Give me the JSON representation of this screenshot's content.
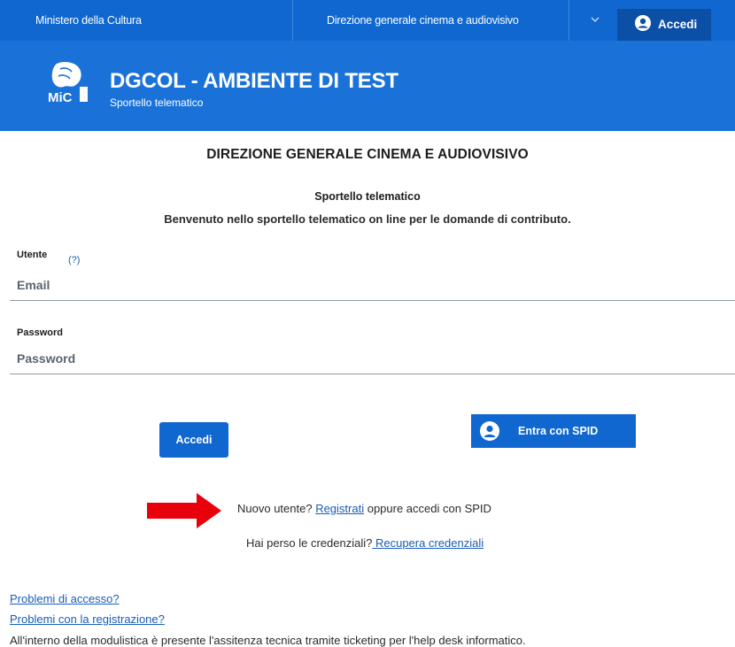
{
  "topbar": {
    "ministry_label": "Ministero della Cultura",
    "direzione_label": "Direzione generale cinema e audiovisivo",
    "login_label": "Accedi"
  },
  "header": {
    "logo_text": "MiC",
    "title": "DGCOL - AMBIENTE DI TEST",
    "subtitle": "Sportello telematico"
  },
  "main": {
    "heading": "DIREZIONE GENERALE CINEMA E AUDIOVISIVO",
    "subheading": "Sportello telematico",
    "welcome": "Benvenuto nello sportello telematico on line per le domande di contributo."
  },
  "form": {
    "user_label": "Utente",
    "user_help": "(?)",
    "email_placeholder": "Email",
    "password_label": "Password",
    "password_placeholder": "Password",
    "login_button": "Accedi",
    "spid_button": "Entra con SPID"
  },
  "register": {
    "prefix": "Nuovo utente? ",
    "link": "Registrati",
    "suffix": " oppure accedi con SPID"
  },
  "recover": {
    "prefix": "Hai perso le credenziali?",
    "link": " Recupera credenziali"
  },
  "footer": {
    "access_problems": "Problemi di accesso?",
    "registration_problems": "Problemi con la registrazione?",
    "helpdesk_note": "All'interno della modulistica è presente l'assitenza tecnica tramite ticketing per l'help desk informatico."
  },
  "colors": {
    "primary": "#0f67cf",
    "header": "#1a72d9",
    "arrow": "#e8000b",
    "link": "#1a5db5"
  }
}
